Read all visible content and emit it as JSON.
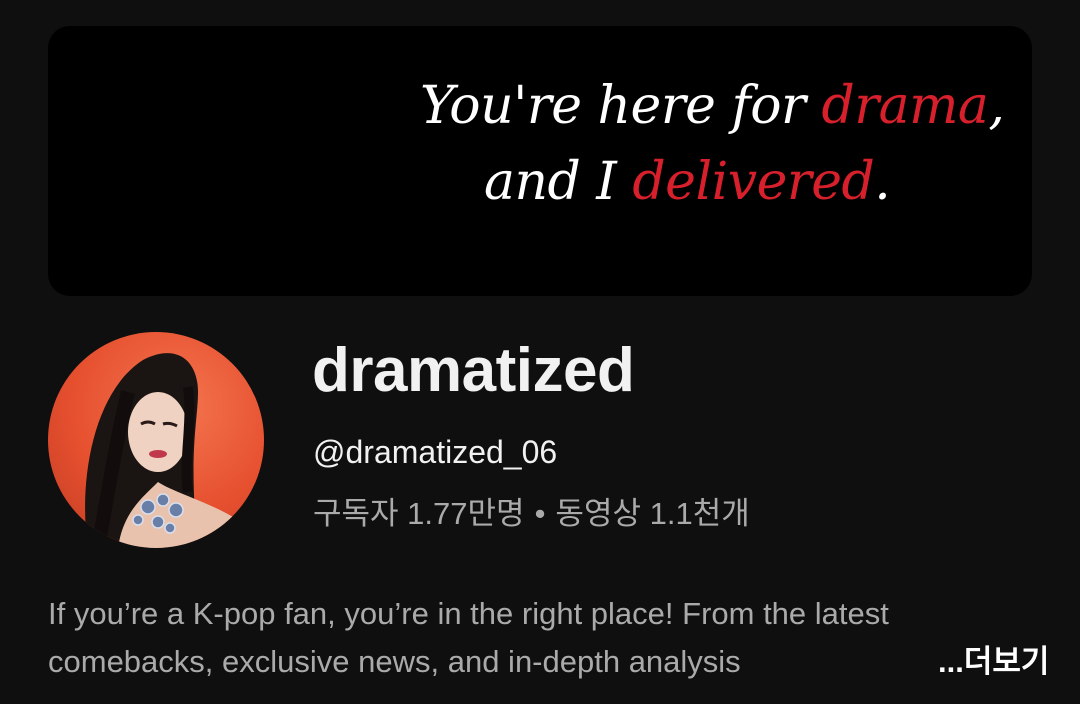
{
  "banner": {
    "line1_prefix": "You're here for ",
    "line1_accent": "drama",
    "line1_suffix": ",",
    "line2_prefix": "and I ",
    "line2_accent": "delivered",
    "line2_suffix": "."
  },
  "channel": {
    "name": "dramatized",
    "handle": "@dramatized_06",
    "subscribers": "구독자 1.77만명",
    "separator": "•",
    "videos": "동영상 1.1천개"
  },
  "description": {
    "line1": "If you’re a K-pop fan, you’re in the right place! From the latest",
    "line2": "comebacks, exclusive news, and in-depth analysis",
    "more_label": "...더보기"
  },
  "colors": {
    "background": "#0f0f0f",
    "accent": "#d8202c",
    "secondary_text": "#aaaaaa"
  },
  "icons": {
    "avatar": "profile-photo"
  }
}
